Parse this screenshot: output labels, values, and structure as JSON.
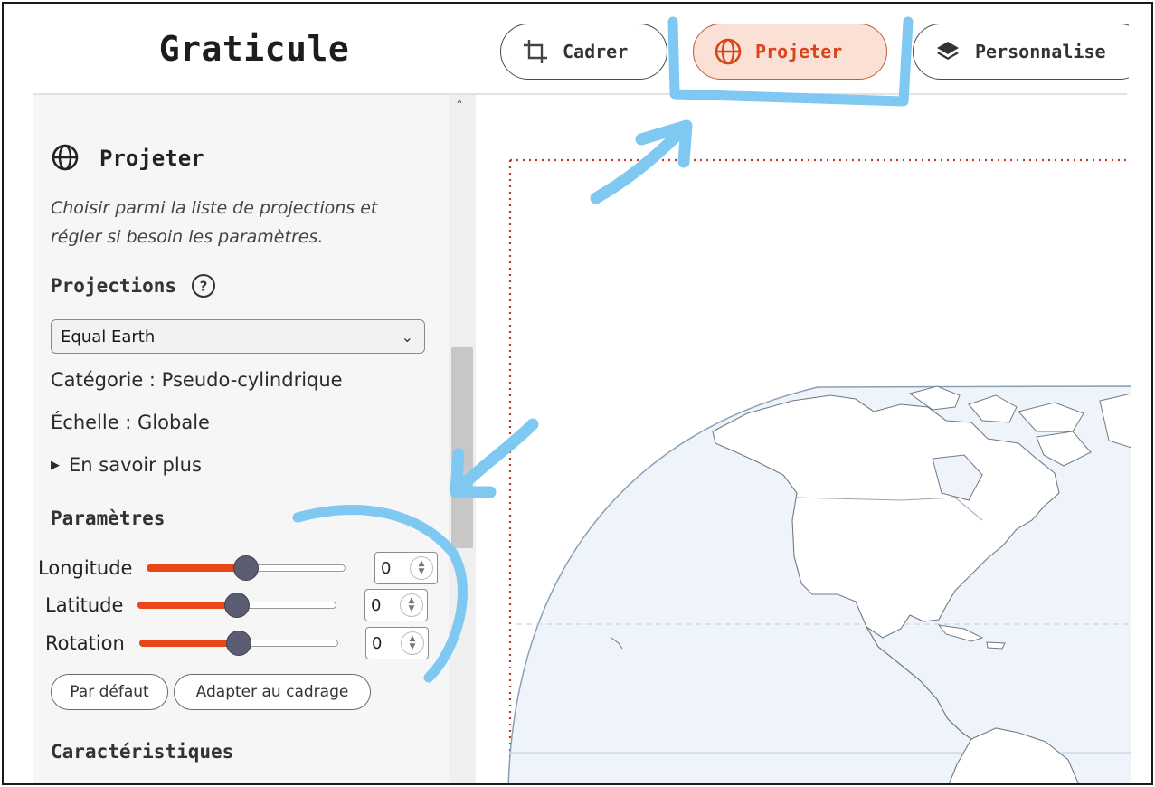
{
  "app": {
    "title": "Graticule"
  },
  "tabs": [
    {
      "label": "Cadrer",
      "icon": "crop-icon",
      "active": false
    },
    {
      "label": "Projeter",
      "icon": "globe-icon",
      "active": true
    },
    {
      "label": "Personnalise",
      "icon": "layers-icon",
      "active": false
    }
  ],
  "sidebar": {
    "title": "Projeter",
    "title_icon": "globe-icon",
    "description": "Choisir parmi la liste de projections et régler si besoin les paramètres.",
    "projections_heading": "Projections",
    "projection_selected": "Equal Earth",
    "category": "Catégorie : Pseudo-cylindrique",
    "scale": "Échelle : Globale",
    "more_label": "En savoir plus",
    "params_heading": "Paramètres",
    "params": [
      {
        "label": "Longitude",
        "value": "0",
        "level": 0.5
      },
      {
        "label": "Latitude",
        "value": "0",
        "level": 0.5
      },
      {
        "label": "Rotation",
        "value": "0",
        "level": 0.5
      }
    ],
    "default_button": "Par défaut",
    "fit_button": "Adapter au cadrage",
    "characteristics_heading": "Caractéristiques"
  },
  "colors": {
    "accent": "#e8461b",
    "active_tab_bg": "#fbe0d6",
    "annotation": "#7ec8f2",
    "frame_border": "#c0392b",
    "ocean": "#eef4fa"
  }
}
